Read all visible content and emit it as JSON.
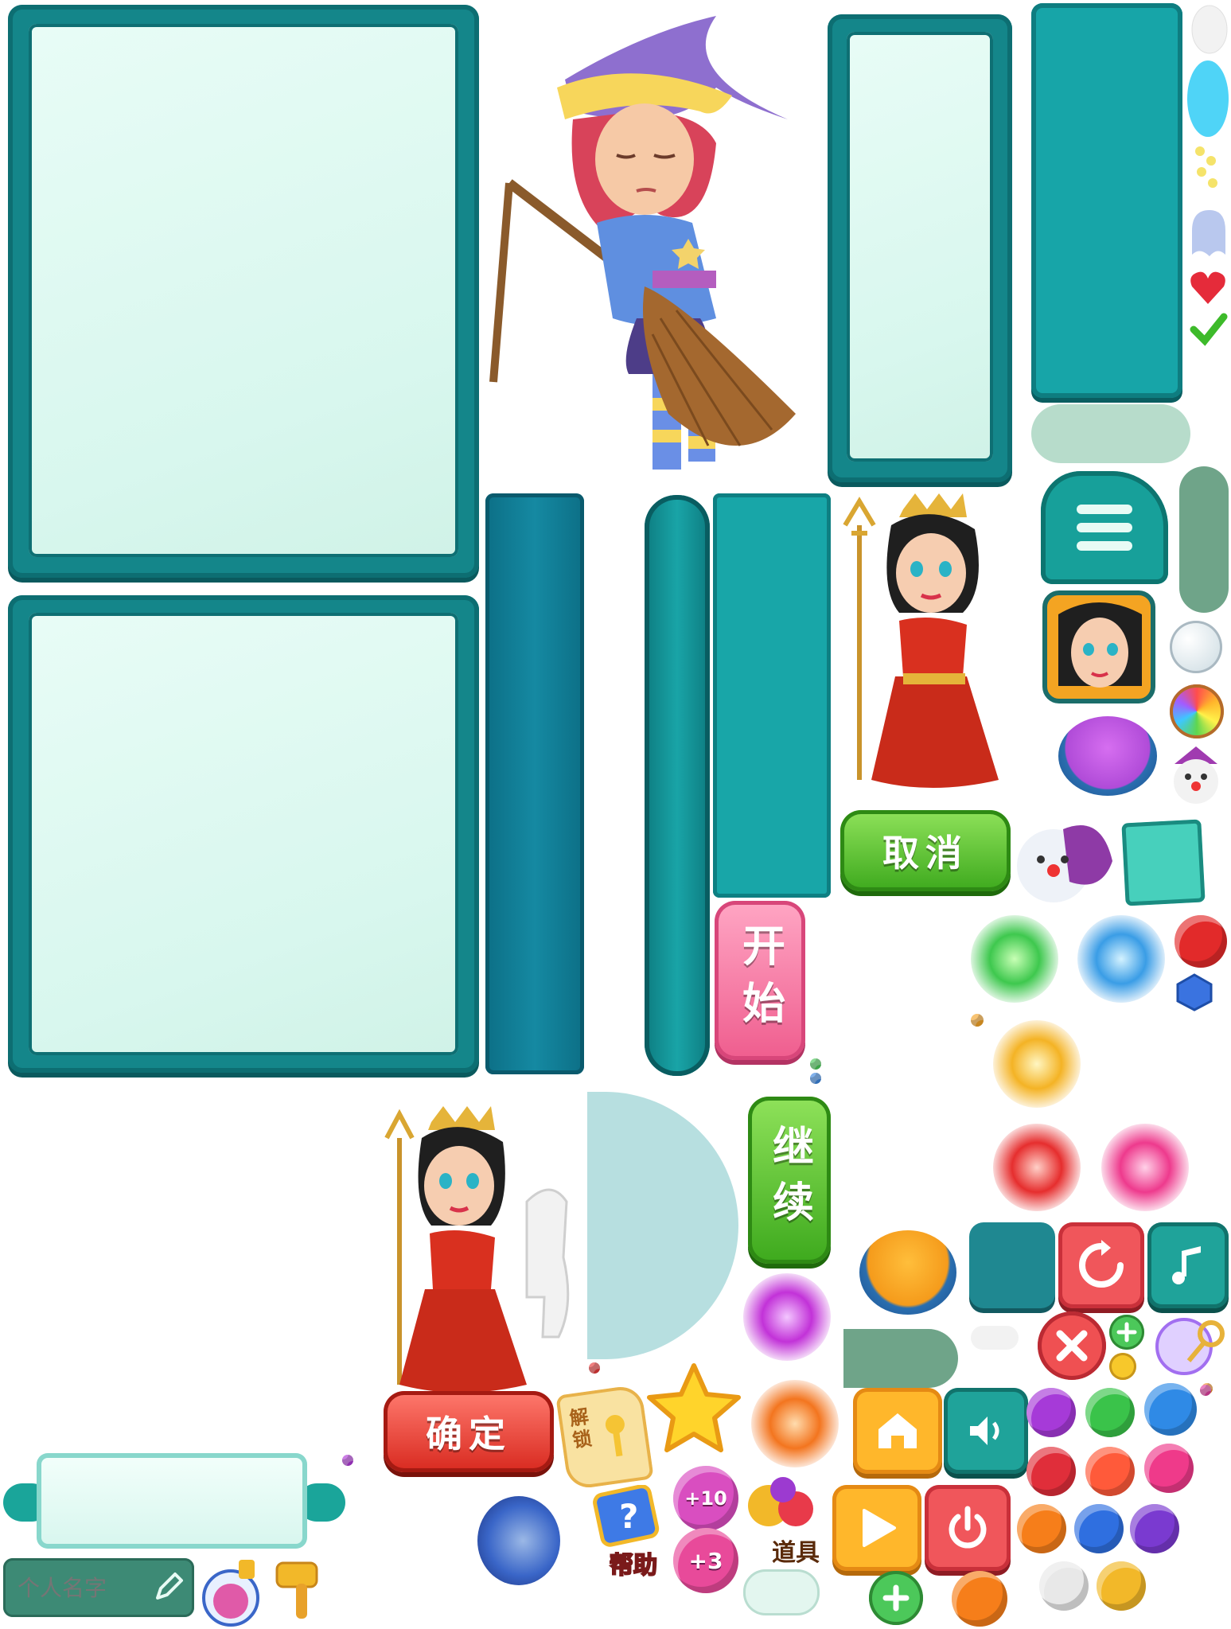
{
  "buttons": {
    "cancel": "取消",
    "start": "开始",
    "continue": "继续",
    "confirm": "确定"
  },
  "labels": {
    "unlock": "解锁",
    "help": "帮助",
    "props": "道具",
    "plus_ten": "+10",
    "plus_three": "+3"
  },
  "name_input": {
    "placeholder": "个人名字"
  },
  "colors": {
    "panel_teal": "#14868a",
    "panel_fill": "#dff9f1",
    "green": "#3da91d",
    "red": "#d8291f",
    "pink": "#ef5d8e",
    "orange": "#ffae2a"
  },
  "icons": [
    "witch-character",
    "queen-character",
    "queen-horse-character",
    "queen-portrait-icon",
    "menu-icon",
    "refresh-icon",
    "music-icon",
    "close-icon",
    "plus-icon",
    "home-icon",
    "sound-icon",
    "play-icon",
    "power-icon",
    "star-icon",
    "heart-icon",
    "check-icon",
    "ghost-icon",
    "magic-orb-icon",
    "bubble-icon",
    "key-icon",
    "pencil-icon",
    "potion-icon",
    "hammer-icon",
    "question-icon"
  ]
}
